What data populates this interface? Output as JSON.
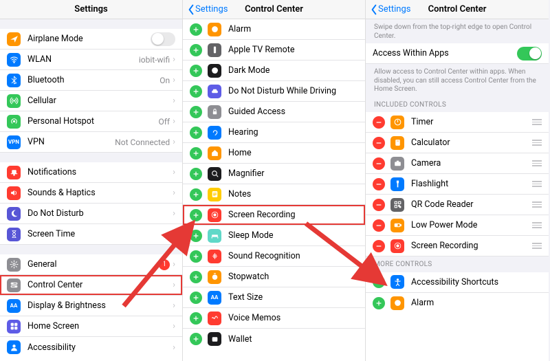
{
  "panel1": {
    "title": "Settings",
    "groups": [
      [
        {
          "icon": "airplane-icon",
          "bg": "bg-orange",
          "label": "Airplane Mode",
          "toggle": "off"
        },
        {
          "icon": "wifi-icon",
          "bg": "bg-blue",
          "label": "WLAN",
          "value": "iobit-wifi",
          "chev": true
        },
        {
          "icon": "bluetooth-icon",
          "bg": "bg-blue",
          "label": "Bluetooth",
          "value": "On",
          "chev": true
        },
        {
          "icon": "cellular-icon",
          "bg": "bg-green",
          "label": "Cellular",
          "chev": true
        },
        {
          "icon": "hotspot-icon",
          "bg": "bg-green",
          "label": "Personal Hotspot",
          "value": "Off",
          "chev": true
        },
        {
          "icon": "vpn-icon",
          "bg": "bg-blue",
          "label": "VPN",
          "value": "Not Connected",
          "chev": true,
          "iconText": "VPN"
        }
      ],
      [
        {
          "icon": "bell-icon",
          "bg": "bg-red",
          "label": "Notifications",
          "chev": true
        },
        {
          "icon": "speaker-icon",
          "bg": "bg-red",
          "label": "Sounds & Haptics",
          "chev": true
        },
        {
          "icon": "moon-icon",
          "bg": "bg-purple",
          "label": "Do Not Disturb",
          "chev": true
        },
        {
          "icon": "hourglass-icon",
          "bg": "bg-purple",
          "label": "Screen Time",
          "chev": true
        }
      ],
      [
        {
          "icon": "gear-icon",
          "bg": "bg-gray",
          "label": "General",
          "badge": "1",
          "chev": true
        },
        {
          "icon": "switches-icon",
          "bg": "bg-gray",
          "label": "Control Center",
          "chev": true,
          "hl": true
        },
        {
          "icon": "textsize-icon",
          "bg": "bg-blue",
          "label": "Display & Brightness",
          "chev": true,
          "iconText": "AA"
        },
        {
          "icon": "grid-icon",
          "bg": "bg-indigo",
          "label": "Home Screen",
          "chev": true
        },
        {
          "icon": "person-icon",
          "bg": "bg-blue",
          "label": "Accessibility",
          "chev": true
        }
      ]
    ]
  },
  "panel2": {
    "back": "Settings",
    "title": "Control Center",
    "items": [
      {
        "icon": "clock-icon",
        "bg": "bg-orange",
        "label": "Alarm"
      },
      {
        "icon": "tvremote-icon",
        "bg": "bg-darkgray",
        "label": "Apple TV Remote"
      },
      {
        "icon": "darkmode-icon",
        "bg": "bg-black",
        "label": "Dark Mode"
      },
      {
        "icon": "car-icon",
        "bg": "bg-indigo",
        "label": "Do Not Disturb While Driving"
      },
      {
        "icon": "lock-icon",
        "bg": "bg-gray",
        "label": "Guided Access"
      },
      {
        "icon": "ear-icon",
        "bg": "bg-blue",
        "label": "Hearing"
      },
      {
        "icon": "home-icon",
        "bg": "bg-orange",
        "label": "Home"
      },
      {
        "icon": "magnifier-icon",
        "bg": "bg-black",
        "label": "Magnifier"
      },
      {
        "icon": "notes-icon",
        "bg": "bg-yellow",
        "label": "Notes"
      },
      {
        "icon": "record-icon",
        "bg": "bg-red",
        "label": "Screen Recording",
        "hl": true
      },
      {
        "icon": "bed-icon",
        "bg": "bg-mint",
        "label": "Sleep Mode"
      },
      {
        "icon": "soundrec-icon",
        "bg": "bg-red",
        "label": "Sound Recognition"
      },
      {
        "icon": "stopwatch-icon",
        "bg": "bg-orange",
        "label": "Stopwatch"
      },
      {
        "icon": "textsize-icon",
        "bg": "bg-blue",
        "label": "Text Size",
        "iconText": "AA"
      },
      {
        "icon": "voicememo-icon",
        "bg": "bg-red",
        "label": "Voice Memos"
      },
      {
        "icon": "wallet-icon",
        "bg": "bg-black",
        "label": "Wallet"
      }
    ]
  },
  "panel3": {
    "back": "Settings",
    "title": "Control Center",
    "intro": "Swipe down from the top-right edge to open Control Center.",
    "accessRow": {
      "label": "Access Within Apps",
      "toggle": "on"
    },
    "accessFooter": "Allow access to Control Center within apps. When disabled, you can still access Control Center from the Home Screen.",
    "includedHeader": "Included Controls",
    "included": [
      {
        "icon": "timer-icon",
        "bg": "bg-orange",
        "label": "Timer"
      },
      {
        "icon": "calculator-icon",
        "bg": "bg-orange",
        "label": "Calculator"
      },
      {
        "icon": "camera-icon",
        "bg": "bg-gray",
        "label": "Camera"
      },
      {
        "icon": "flashlight-icon",
        "bg": "bg-blue",
        "label": "Flashlight"
      },
      {
        "icon": "qrcode-icon",
        "bg": "bg-darkgray",
        "label": "QR Code Reader"
      },
      {
        "icon": "battery-icon",
        "bg": "bg-orange",
        "label": "Low Power Mode"
      },
      {
        "icon": "record-icon",
        "bg": "bg-red",
        "label": "Screen Recording"
      }
    ],
    "moreHeader": "More Controls",
    "more": [
      {
        "icon": "accessibility-icon",
        "bg": "bg-blue",
        "label": "Accessibility Shortcuts"
      },
      {
        "icon": "clock-icon",
        "bg": "bg-orange",
        "label": "Alarm"
      }
    ]
  }
}
